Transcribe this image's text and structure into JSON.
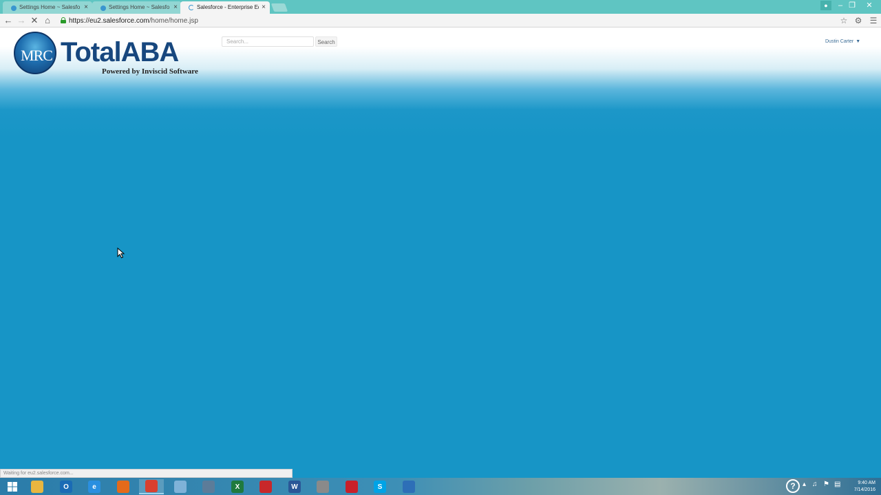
{
  "browser": {
    "tabs": [
      {
        "title": "Settings Home ~ Salesfo",
        "active": false,
        "loading": false
      },
      {
        "title": "Settings Home ~ Salesfo",
        "active": false,
        "loading": false
      },
      {
        "title": "Salesforce - Enterprise Ed",
        "active": true,
        "loading": true
      }
    ],
    "url_host": "https://eu2.salesforce.com",
    "url_path": "/home/home.jsp",
    "status_text": "Waiting for eu2.salesforce.com..."
  },
  "header": {
    "logo_mark": "MRC",
    "logo_wordmark": "TotalABA",
    "logo_tagline": "Powered by Inviscid Software",
    "search_placeholder": "Search...",
    "search_button": "Search",
    "user_name": "Dustin Carter"
  },
  "taskbar": {
    "apps": [
      {
        "name": "file-explorer",
        "glyph": "",
        "color": "#e8b640"
      },
      {
        "name": "outlook",
        "glyph": "O",
        "color": "#1a6bb5"
      },
      {
        "name": "internet-explorer",
        "glyph": "e",
        "color": "#2a8fe0"
      },
      {
        "name": "firefox",
        "glyph": "",
        "color": "#e46a1a"
      },
      {
        "name": "chrome",
        "glyph": "",
        "color": "#d9402f"
      },
      {
        "name": "notepad",
        "glyph": "",
        "color": "#7fb2d8"
      },
      {
        "name": "calculator",
        "glyph": "",
        "color": "#5c7c99"
      },
      {
        "name": "excel",
        "glyph": "X",
        "color": "#1f7a3e"
      },
      {
        "name": "acrobat",
        "glyph": "",
        "color": "#c8272a"
      },
      {
        "name": "word",
        "glyph": "W",
        "color": "#2b5797"
      },
      {
        "name": "paint",
        "glyph": "",
        "color": "#8a8a8a"
      },
      {
        "name": "app-red",
        "glyph": "",
        "color": "#c8202a"
      },
      {
        "name": "skype",
        "glyph": "S",
        "color": "#00a3e6"
      },
      {
        "name": "network-app",
        "glyph": "",
        "color": "#2d6fb7"
      }
    ],
    "clock_time": "9:40 AM",
    "clock_date": "7/14/2016"
  },
  "colors": {
    "page_blue": "#1795c6",
    "tab_strip": "#5fc5c2",
    "brand_navy": "#17477e"
  }
}
